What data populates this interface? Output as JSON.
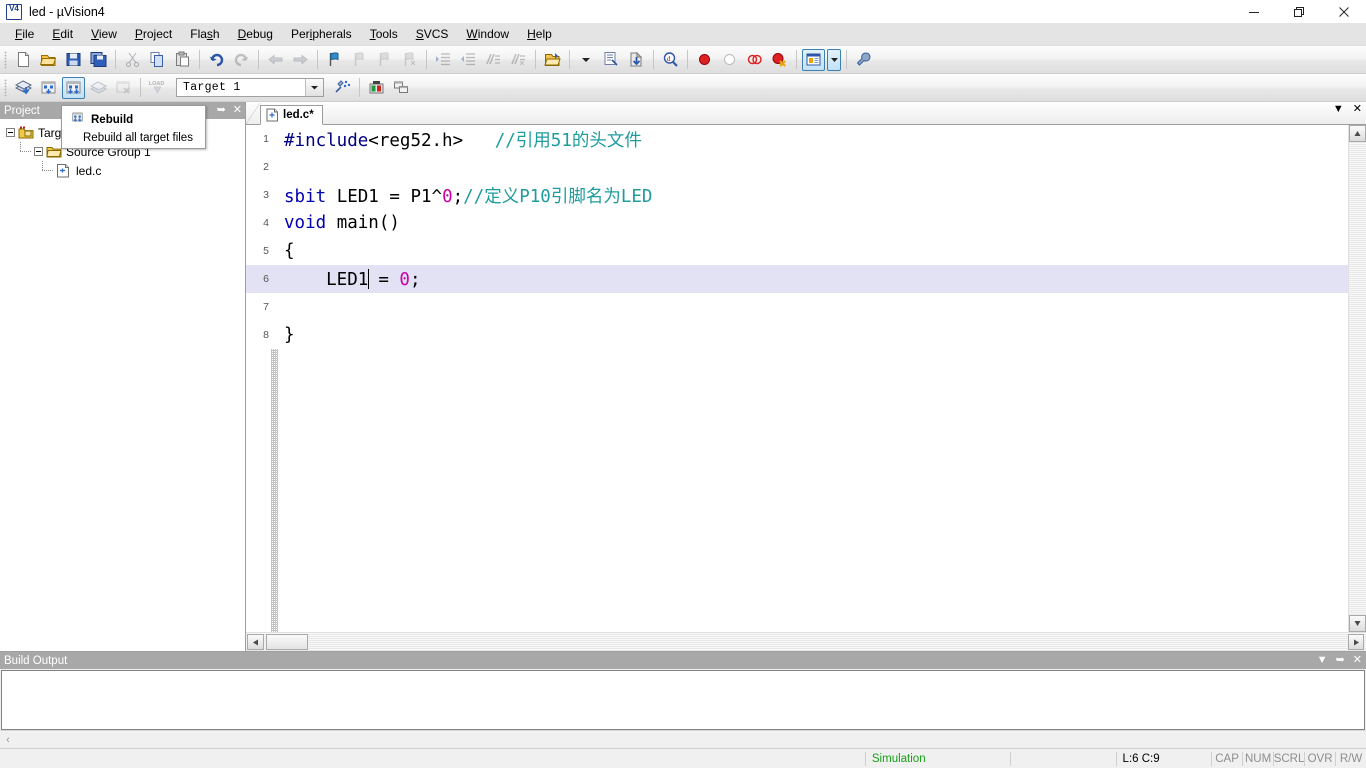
{
  "window": {
    "title": "led  - µVision4",
    "icon": "keil-uvision-icon",
    "controls": {
      "minimize": "minimize-icon",
      "restore": "restore-icon",
      "close": "close-icon"
    }
  },
  "menubar": {
    "items": [
      {
        "label": "File",
        "accel": "F"
      },
      {
        "label": "Edit",
        "accel": "E"
      },
      {
        "label": "View",
        "accel": "V"
      },
      {
        "label": "Project",
        "accel": "P"
      },
      {
        "label": "Flash",
        "accel": "s"
      },
      {
        "label": "Debug",
        "accel": "D"
      },
      {
        "label": "Peripherals",
        "accel": "i"
      },
      {
        "label": "Tools",
        "accel": "T"
      },
      {
        "label": "SVCS",
        "accel": "S"
      },
      {
        "label": "Window",
        "accel": "W"
      },
      {
        "label": "Help",
        "accel": "H"
      }
    ]
  },
  "toolbar_main": {
    "buttons": [
      "new-file-icon",
      "open-file-icon",
      "save-icon",
      "save-all-icon",
      "cut-icon",
      "copy-icon",
      "paste-icon",
      "undo-icon",
      "redo-icon",
      "navigate-back-icon",
      "navigate-forward-icon",
      "toggle-bookmark-icon",
      "next-bookmark-icon",
      "previous-bookmark-icon",
      "clear-bookmarks-icon",
      "indent-icon",
      "outdent-icon",
      "comment-icon",
      "uncomment-icon",
      "open-folder-icon"
    ]
  },
  "toolbar_build": {
    "buttons": [
      "translate-file-icon",
      "build-target-icon",
      "rebuild-all-icon",
      "batch-build-icon",
      "stop-build-icon",
      "download-icon"
    ],
    "active_button": "rebuild-all-icon",
    "target_combo": {
      "value": "Target 1",
      "dropdown_icon": "chevron-down-icon"
    },
    "extra_buttons": [
      "target-options-icon",
      "manage-components-icon",
      "multi-project-icon"
    ],
    "debug_buttons": [
      "options-dropdown-icon",
      "source-browse-icon",
      "find-in-files-icon",
      "magnifier-d-icon",
      "insert-breakpoint-icon",
      "kill-breakpoint-icon",
      "disable-breakpoint-icon",
      "kill-all-breakpoints-icon",
      "window-layout-icon",
      "window-layout-dropdown-icon",
      "configuration-wrench-icon"
    ]
  },
  "project_pane": {
    "title": "Project",
    "pin_icon": "pin-icon",
    "close_icon": "close-icon",
    "tree": [
      {
        "label": "Target 1",
        "icon": "target-icon",
        "level": 0,
        "expander": "collapse-icon"
      },
      {
        "label": "Source Group 1",
        "icon": "folder-icon",
        "level": 1,
        "expander": "collapse-icon"
      },
      {
        "label": "led.c",
        "icon": "c-file-icon",
        "level": 2,
        "expander": ""
      }
    ]
  },
  "tooltip": {
    "icon": "rebuild-all-icon",
    "title": "Rebuild",
    "description": "Rebuild all target files"
  },
  "editor": {
    "tab": {
      "label": "led.c*",
      "icon": "c-file-icon"
    },
    "tabstrip_buttons": {
      "dropdown": "chevron-down-icon",
      "close": "close-icon"
    },
    "lines": [
      {
        "number": "1",
        "highlight": false,
        "tokens": [
          {
            "text": "#include",
            "cls": "pp"
          },
          {
            "text": "<reg52.h>",
            "cls": "plain"
          },
          {
            "text": "   ",
            "cls": "plain"
          },
          {
            "text": "//引用51的头文件",
            "cls": "cmt"
          }
        ]
      },
      {
        "number": "2",
        "highlight": false,
        "tokens": []
      },
      {
        "number": "3",
        "highlight": false,
        "tokens": [
          {
            "text": "sbit",
            "cls": "kw"
          },
          {
            "text": " LED1 = P1^",
            "cls": "plain"
          },
          {
            "text": "0",
            "cls": "num"
          },
          {
            "text": ";",
            "cls": "plain"
          },
          {
            "text": "//定义P10引脚名为LED",
            "cls": "cmt"
          }
        ]
      },
      {
        "number": "4",
        "highlight": false,
        "tokens": [
          {
            "text": "void",
            "cls": "kw"
          },
          {
            "text": " main()",
            "cls": "plain"
          }
        ]
      },
      {
        "number": "5",
        "highlight": false,
        "tokens": [
          {
            "text": "{",
            "cls": "plain"
          }
        ]
      },
      {
        "number": "6",
        "highlight": true,
        "caret_after": 1,
        "tokens": [
          {
            "text": "    LED1",
            "cls": "plain"
          },
          {
            "text": " = ",
            "cls": "plain"
          },
          {
            "text": "0",
            "cls": "num"
          },
          {
            "text": ";",
            "cls": "plain"
          }
        ]
      },
      {
        "number": "7",
        "highlight": false,
        "tokens": []
      },
      {
        "number": "8",
        "highlight": false,
        "tokens": [
          {
            "text": "}",
            "cls": "plain"
          }
        ]
      }
    ],
    "scroll": {
      "up_icon": "scroll-up-icon",
      "down_icon": "scroll-down-icon",
      "left_icon": "scroll-left-icon",
      "right_icon": "scroll-right-icon"
    }
  },
  "build_output": {
    "title": "Build Output",
    "dropdown_icon": "chevron-down-icon",
    "pin_icon": "pin-icon",
    "close_icon": "close-icon",
    "content": "",
    "scroll_left_icon": "scroll-left-icon"
  },
  "statusbar": {
    "simulation": "Simulation",
    "position": "L:6 C:9",
    "flags": [
      "CAP",
      "NUM",
      "SCRL",
      "OVR",
      "R/W"
    ]
  },
  "colors": {
    "accent_blue": "#3c7fb1",
    "comment_teal": "#1f9c9c",
    "keyword_blue": "#0000b0",
    "number_magenta": "#cc00aa",
    "preprocessor_navy": "#000080",
    "simulation_green": "#18a018",
    "panel_header_gray": "#a8a8a8",
    "line_highlight": "#e2e2f4"
  }
}
